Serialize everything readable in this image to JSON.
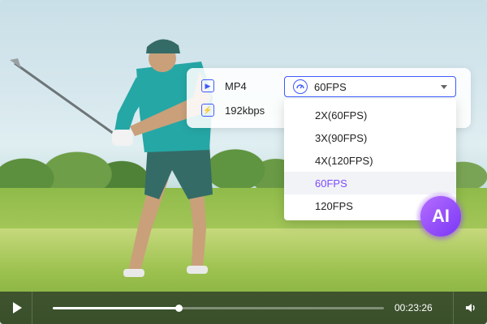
{
  "format": {
    "container": "MP4",
    "bitrate": "192kbps"
  },
  "framerate": {
    "selected": "60FPS",
    "options": [
      "2X(60FPS)",
      "3X(90FPS)",
      "4X(120FPS)",
      "60FPS",
      "120FPS"
    ],
    "selected_index": 3
  },
  "ai_badge": "AI",
  "player": {
    "time": "00:23:26",
    "progress": 0.38
  },
  "colors": {
    "accent": "#3d5afe",
    "selected": "#7b4dff",
    "ai": "#9b4dff"
  },
  "icons": {
    "video": "video-camera-icon",
    "bitrate": "lightning-icon",
    "fps": "speed-gauge-icon",
    "play": "play-icon",
    "volume": "volume-icon"
  }
}
